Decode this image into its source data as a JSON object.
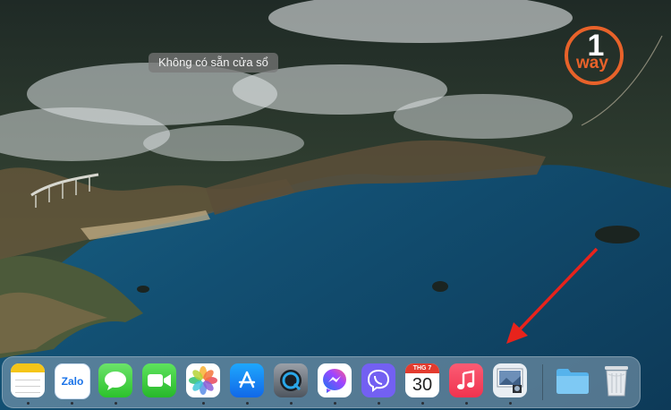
{
  "tooltip": {
    "text": "Không có sẵn cửa sổ"
  },
  "logo": {
    "text": "way",
    "numeral": "1"
  },
  "dock": {
    "apps": [
      {
        "name": "Notes",
        "icon": "notes-icon",
        "running": true
      },
      {
        "name": "Zalo",
        "icon": "zalo-icon",
        "label": "Zalo",
        "running": true
      },
      {
        "name": "Messages",
        "icon": "messages-icon",
        "running": true
      },
      {
        "name": "FaceTime",
        "icon": "facetime-icon",
        "running": false
      },
      {
        "name": "Photos",
        "icon": "photos-icon",
        "running": true
      },
      {
        "name": "App Store",
        "icon": "app-store-icon",
        "running": true
      },
      {
        "name": "QuickTime Player",
        "icon": "quicktime-icon",
        "running": true
      },
      {
        "name": "Messenger",
        "icon": "messenger-icon",
        "running": true
      },
      {
        "name": "Viber",
        "icon": "viber-icon",
        "running": true
      },
      {
        "name": "Calendar",
        "icon": "calendar-icon",
        "month": "THG 7",
        "day": "30",
        "running": true
      },
      {
        "name": "Music",
        "icon": "music-icon",
        "running": true
      },
      {
        "name": "Preview",
        "icon": "preview-icon",
        "running": true
      }
    ],
    "folder": {
      "name": "Downloads",
      "icon": "folder-icon"
    },
    "trash": {
      "name": "Trash",
      "icon": "trash-icon"
    }
  },
  "colors": {
    "arrow": "#e8231c",
    "logo_orange": "#e8622a"
  }
}
